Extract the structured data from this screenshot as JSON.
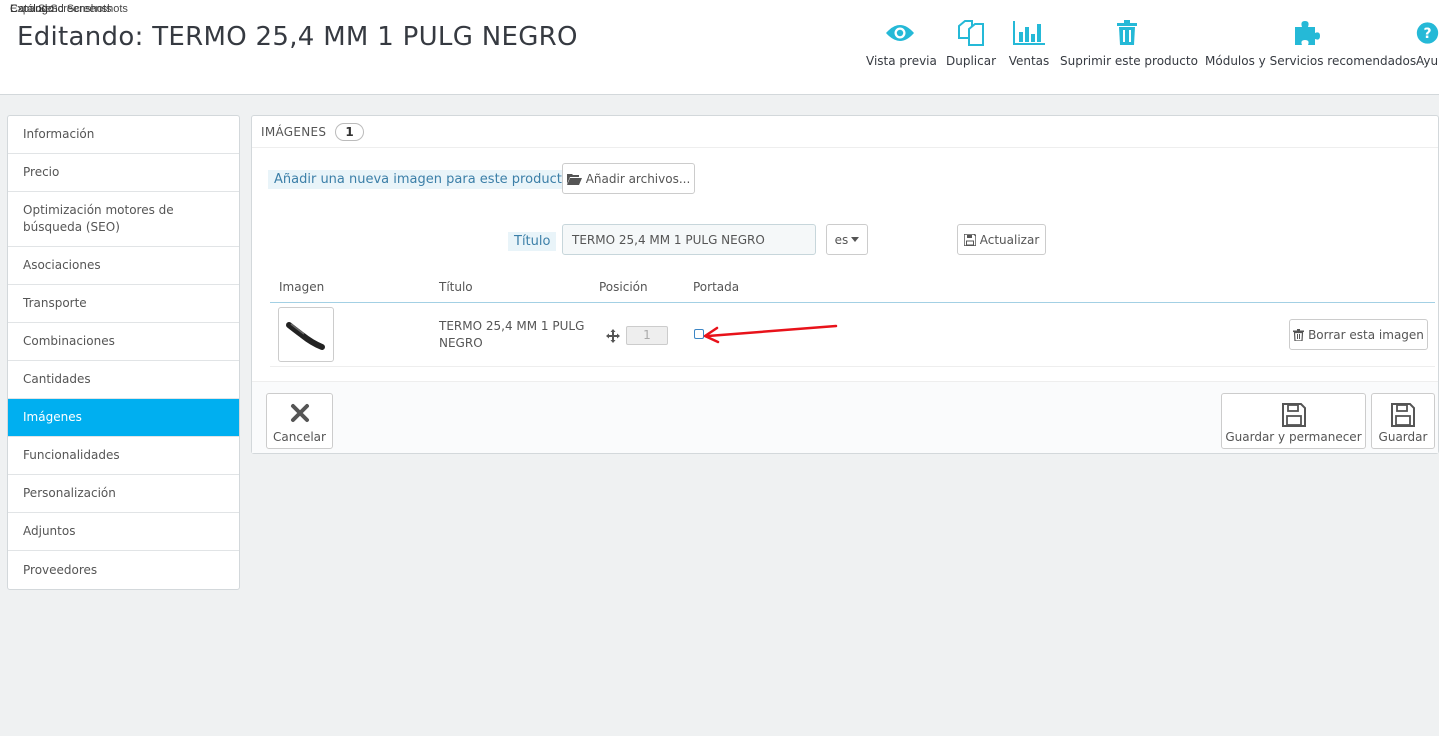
{
  "breadcrumb": {
    "overlap_text_1": "Catálogo",
    "overlap_text_2": "Expand Screenshots",
    "overlap_text_3": "Send Screenshots"
  },
  "header": {
    "title": "Editando: TERMO 25,4 MM 1 PULG NEGRO",
    "toolbar": {
      "preview": "Vista previa",
      "duplicate": "Duplicar",
      "sales": "Ventas",
      "delete": "Suprimir este producto",
      "modules": "Módulos y Servicios recomendados",
      "help": "Ayu"
    }
  },
  "sidebar": {
    "items": [
      {
        "label": "Información"
      },
      {
        "label": "Precio"
      },
      {
        "label": "Optimización motores de búsqueda (SEO)"
      },
      {
        "label": "Asociaciones"
      },
      {
        "label": "Transporte"
      },
      {
        "label": "Combinaciones"
      },
      {
        "label": "Cantidades"
      },
      {
        "label": "Imágenes"
      },
      {
        "label": "Funcionalidades"
      },
      {
        "label": "Personalización"
      },
      {
        "label": "Adjuntos"
      },
      {
        "label": "Proveedores"
      }
    ],
    "active_index": 7
  },
  "panel": {
    "heading": "IMÁGENES",
    "count": "1",
    "add_image_label": "Añadir una nueva imagen para este producto",
    "add_files_button": "Añadir archivos...",
    "title_label": "Título",
    "title_value": "TERMO 25,4 MM 1 PULG NEGRO",
    "language": "es",
    "update_button": "Actualizar",
    "table": {
      "headers": [
        "Imagen",
        "Título",
        "Posición",
        "Portada"
      ],
      "rows": [
        {
          "title": "TERMO 25,4 MM 1 PULG NEGRO",
          "position": "1",
          "cover": false,
          "delete_label": "Borrar esta imagen"
        }
      ]
    },
    "footer": {
      "cancel": "Cancelar",
      "save_and_stay": "Guardar y permanecer",
      "save": "Guardar"
    }
  },
  "colors": {
    "accent": "#00aff0",
    "toolbar_icon": "#25b9d7",
    "annotation": "#e8121a"
  }
}
